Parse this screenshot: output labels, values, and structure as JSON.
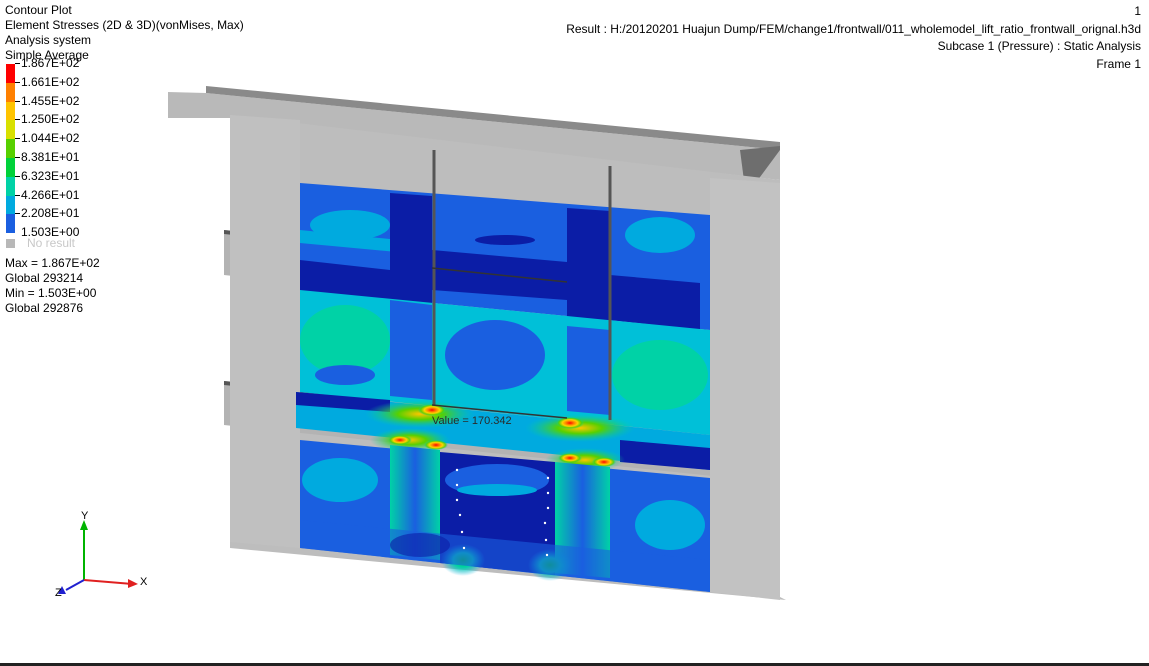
{
  "header": {
    "title": "Contour Plot",
    "subtitle": "Element Stresses (2D & 3D)(vonMises, Max)",
    "system": "Analysis system",
    "averaging": "Simple Average"
  },
  "info": {
    "frame_number": "1",
    "result": "Result : H:/20120201 Huajun Dump/FEM/change1/frontwall/011_wholemodel_lift_ratio_frontwall_orignal.h3d",
    "subcase": "Subcase 1 (Pressure) : Static Analysis",
    "frame": "Frame 1"
  },
  "legend": {
    "levels": [
      {
        "label": "1.867E+02",
        "color": "#ff0000"
      },
      {
        "label": "1.661E+02",
        "color": "#ff8000"
      },
      {
        "label": "1.455E+02",
        "color": "#ffc400"
      },
      {
        "label": "1.250E+02",
        "color": "#d8e000"
      },
      {
        "label": "1.044E+02",
        "color": "#57d000"
      },
      {
        "label": "8.381E+01",
        "color": "#00d23a"
      },
      {
        "label": "6.323E+01",
        "color": "#00d2a6"
      },
      {
        "label": "4.266E+01",
        "color": "#00aadf"
      },
      {
        "label": "2.208E+01",
        "color": "#1a5fe0"
      },
      {
        "label": "1.503E+00",
        "color": "#0b1da6"
      }
    ],
    "no_result": "No result",
    "no_result_color": "#b8b8b8"
  },
  "stats": {
    "max": "Max = 1.867E+02",
    "max_global": "Global 293214",
    "min": "Min = 1.503E+00",
    "min_global": "Global 292876"
  },
  "probe": {
    "label": "Value = 170.342"
  },
  "triad": {
    "x": "X",
    "y": "Y",
    "z": "Z"
  },
  "colors": {
    "model_grey": "#b9b9b9",
    "model_dark": "#6e6e6e",
    "blue_dark": "#0b1da6",
    "blue": "#1a5fe0",
    "cyan": "#00c0d8",
    "green": "#00d23a"
  }
}
